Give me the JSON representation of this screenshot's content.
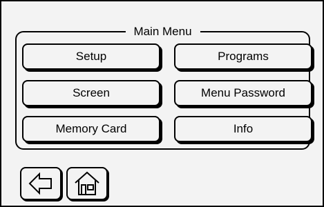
{
  "main_menu": {
    "title": "Main Menu",
    "buttons": [
      {
        "label": "Setup"
      },
      {
        "label": "Programs"
      },
      {
        "label": "Screen"
      },
      {
        "label": "Menu Password"
      },
      {
        "label": "Memory Card"
      },
      {
        "label": "Info"
      }
    ]
  },
  "navigation": {
    "back_icon": "left-arrow-icon",
    "home_icon": "home-icon"
  },
  "colors": {
    "background": "#f3f3f3",
    "border": "#000000"
  }
}
